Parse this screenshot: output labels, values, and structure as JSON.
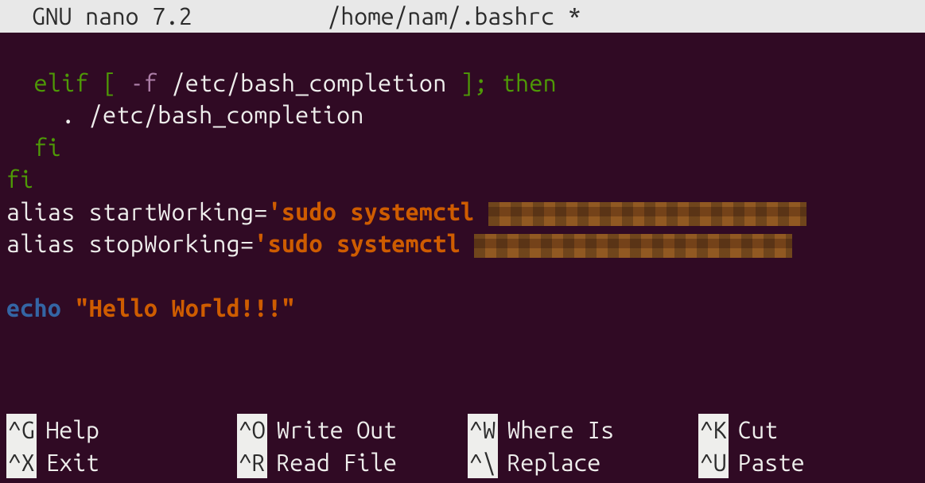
{
  "titlebar": {
    "app": "GNU nano 7.2",
    "filepath": "/home/nam/.bashrc *"
  },
  "code": {
    "l1_elif": "elif",
    "l1_bracket_open": " [ ",
    "l1_flag": "-f",
    "l1_path": " /etc/bash_completion ",
    "l1_bracket_close": "];",
    "l1_then": " then",
    "l2": "    . /etc/bash_completion",
    "l3_fi": "  fi",
    "l4_fi": "fi",
    "l5_alias": "alias startWorking=",
    "l5_str": "'sudo systemctl ",
    "l6_alias": "alias stopWorking=",
    "l6_str": "'sudo systemctl ",
    "l7_echo": "echo",
    "l7_space": " ",
    "l7_str": "\"Hello World!!!\""
  },
  "shortcuts": {
    "row1": [
      {
        "key": "^G",
        "label": "Help"
      },
      {
        "key": "^O",
        "label": "Write Out"
      },
      {
        "key": "^W",
        "label": "Where Is"
      },
      {
        "key": "^K",
        "label": "Cut"
      }
    ],
    "row2": [
      {
        "key": "^X",
        "label": "Exit"
      },
      {
        "key": "^R",
        "label": "Read File"
      },
      {
        "key": "^\\",
        "label": "Replace"
      },
      {
        "key": "^U",
        "label": "Paste"
      }
    ]
  }
}
